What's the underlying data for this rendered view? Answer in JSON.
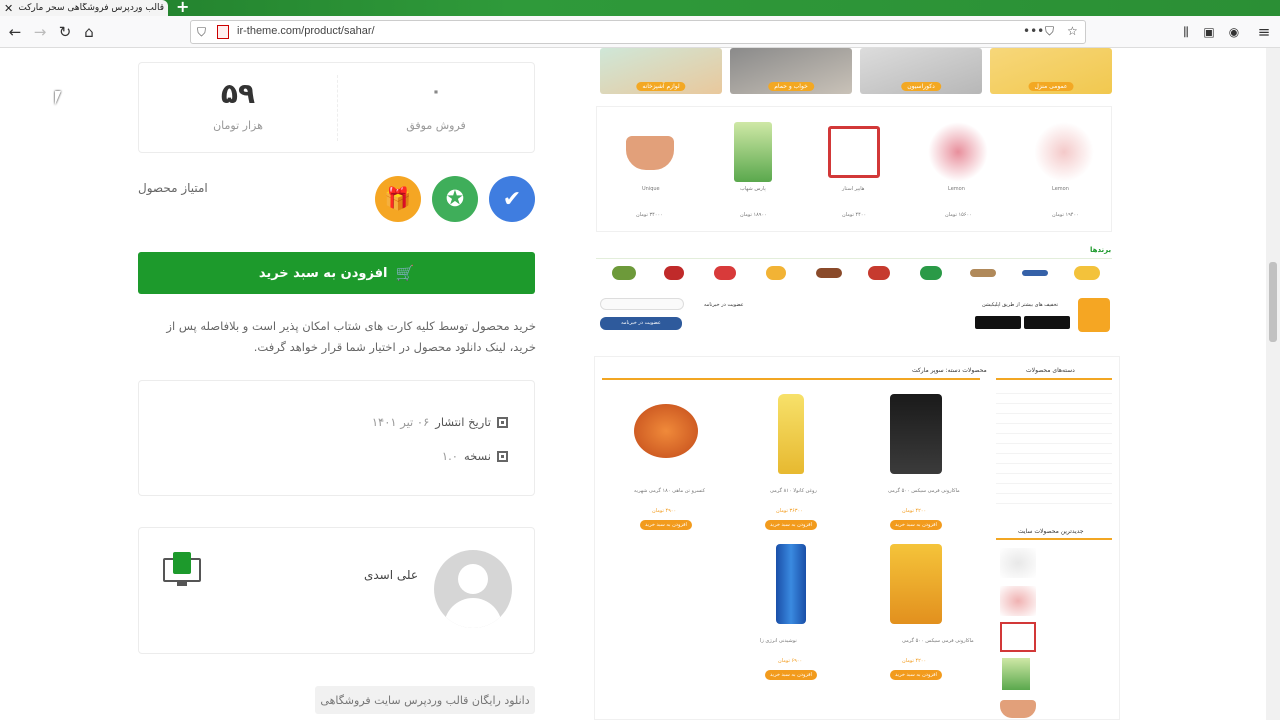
{
  "browser": {
    "tab_title": "قالب وردپرس فروشگاهی سحر مارکت",
    "url": "ir-theme.com/product/sahar/"
  },
  "product_panel": {
    "price_value": "۵۹",
    "price_unit": "هزار تومان",
    "sales_value": "۰",
    "sales_label": "فروش موفق",
    "rating_label": "امتیاز محصول",
    "add_to_cart": "افزودن به سبد خرید",
    "description": "خرید محصول توسط کلیه کارت های شتاب امکان پذیر است و بلافاصله پس از خرید، لینک دانلود محصول در اختیار شما قرار خواهد گرفت.",
    "publish_label": "تاریخ انتشار",
    "publish_value": "۰۶ تیر ۱۴۰۱",
    "version_label": "نسخه",
    "version_value": "۱.۰",
    "author_name": "علی اسدی",
    "tag_button": "دانلود رایگان قالب وردپرس سایت فروشگاهی"
  },
  "preview": {
    "categories": [
      "عمومی منزل",
      "دکوراسیون",
      "خواب و حمام",
      "لوازم آشپزخانه"
    ],
    "row_products": [
      {
        "name": "Lemon",
        "price": "۱۹۴۰۰ تومان"
      },
      {
        "name": "Lemon",
        "price": "۱۵۶۰۰ تومان"
      },
      {
        "name": "هایپر استار",
        "price": "۴۴۰۰ تومان"
      },
      {
        "name": "پارس شهاب",
        "price": "۱۸۹۰۰ تومان"
      },
      {
        "name": "Unique",
        "price": "۳۴۰۰۰ تومان"
      }
    ],
    "brands_title": "برندها",
    "app_text": "تخفیف های بیشتر از طریق اپلیکیشن",
    "newsletter_title": "عضویت در خبرنامه",
    "newsletter_button": "عضویت در خبرنامه",
    "section_title": "محصولات دسته: سوپر مارکت",
    "sidebar_title": "دسته‌های محصولات",
    "sidebar_title2": "جدیدترین محصولات سایت",
    "grid_products": [
      {
        "name": "ماکارونی فرمی سیکس ۵۰۰ گرمی",
        "price": "۴۲۰۰ تومان"
      },
      {
        "name": "روغن کانولا ۸۱۰ گرمی",
        "price": "۳۶۳۰۰ تومان"
      },
      {
        "name": "کنسرو تن ماهی ۱۸۰ گرمی شهریه",
        "price": "۴۹۰۰ تومان"
      },
      {
        "name": "ماکارونی فرمی سیکس ۵۰۰ گرمی",
        "price": "۴۲۰۰ تومان"
      },
      {
        "name": "نوشیدنی انرژی زا",
        "price": "۶۹۰۰ تومان"
      }
    ],
    "order_button": "افزودن به سبد خرید"
  }
}
